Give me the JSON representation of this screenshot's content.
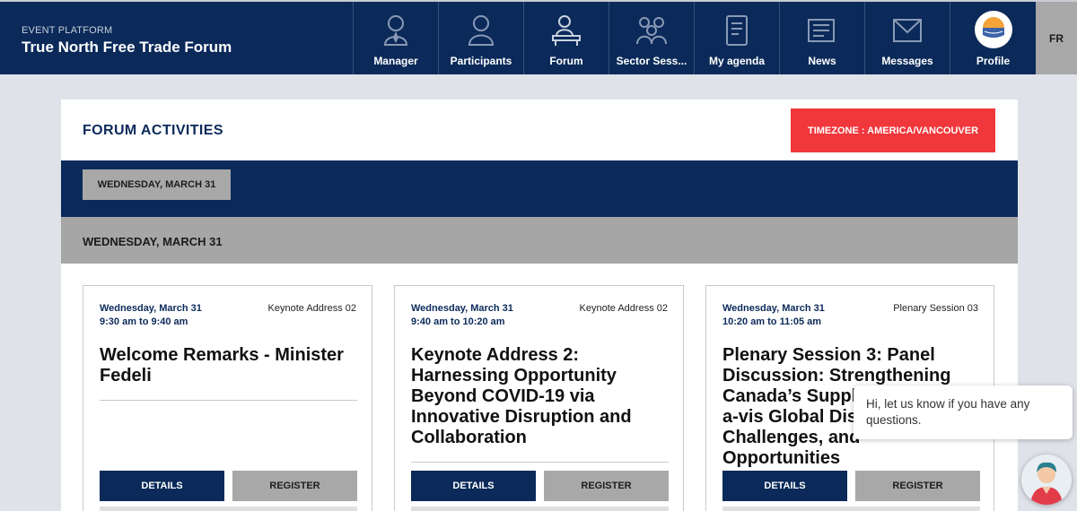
{
  "header": {
    "subtitle": "EVENT PLATFORM",
    "title": "True North Free Trade Forum",
    "nav": [
      {
        "label": "Manager",
        "icon": "manager-icon"
      },
      {
        "label": "Participants",
        "icon": "participants-icon"
      },
      {
        "label": "Forum",
        "icon": "forum-icon"
      },
      {
        "label": "Sector Sess...",
        "icon": "sector-sessions-icon"
      },
      {
        "label": "My agenda",
        "icon": "agenda-icon"
      },
      {
        "label": "News",
        "icon": "news-icon"
      },
      {
        "label": "Messages",
        "icon": "messages-icon"
      },
      {
        "label": "Profile",
        "icon": "profile-logo"
      }
    ],
    "lang": "FR"
  },
  "main": {
    "title": "FORUM ACTIVITIES",
    "timezone_button": "TIMEZONE : AMERICA/VANCOUVER",
    "date_tab": "WEDNESDAY, MARCH 31",
    "day_header": "WEDNESDAY, MARCH 31",
    "cards": [
      {
        "date": "Wednesday, March 31",
        "time": "9:30 am to 9:40 am",
        "category": "Keynote Address 02",
        "title": "Welcome Remarks - Minister Fedeli",
        "details": "DETAILS",
        "register": "REGISTER"
      },
      {
        "date": "Wednesday, March 31",
        "time": "9:40 am to 10:20 am",
        "category": "Keynote Address 02",
        "title": "Keynote Address 2: Harnessing Opportunity Beyond COVID-19 via Innovative Disruption and Collaboration",
        "details": "DETAILS",
        "register": "REGISTER"
      },
      {
        "date": "Wednesday, March 31",
        "time": "10:20 am to 11:05 am",
        "category": "Plenary Session 03",
        "title": "Plenary Session 3: Panel Discussion: Strengthening Canada’s Supply Chains vis-a-vis Global Disruptions: Challenges, and Opportunities",
        "details": "DETAILS",
        "register": "REGISTER"
      }
    ]
  },
  "chat": {
    "message": "Hi, let us know if you have any questions."
  },
  "colors": {
    "navy": "#0b2a5a",
    "accent_red": "#f0373b",
    "gray": "#a8a8a8"
  }
}
